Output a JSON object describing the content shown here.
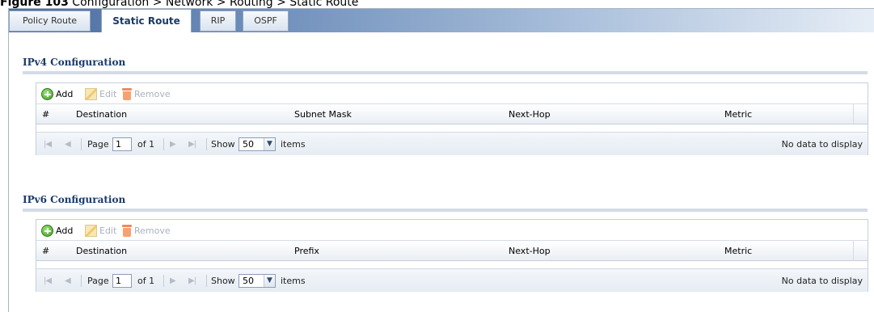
{
  "caption": {
    "figure": "Figure 103",
    "path": "  Configuration > Network > Routing > Static Route"
  },
  "tabs": [
    {
      "label": "Policy Route",
      "active": false
    },
    {
      "label": "Static Route",
      "active": true
    },
    {
      "label": "RIP",
      "active": false
    },
    {
      "label": "OSPF",
      "active": false
    }
  ],
  "ipv4": {
    "title": "IPv4 Configuration",
    "toolbar": {
      "add": "Add",
      "edit": "Edit",
      "remove": "Remove"
    },
    "columns": [
      "#",
      "Destination",
      "Subnet Mask",
      "Next-Hop",
      "Metric"
    ],
    "pager": {
      "page_label": "Page",
      "page_value": "1",
      "of_label": "of 1",
      "show_label": "Show",
      "show_value": "50",
      "items_label": "items",
      "empty_text": "No data to display"
    }
  },
  "ipv6": {
    "title": "IPv6 Configuration",
    "toolbar": {
      "add": "Add",
      "edit": "Edit",
      "remove": "Remove"
    },
    "columns": [
      "#",
      "Destination",
      "Prefix",
      "Next-Hop",
      "Metric"
    ],
    "pager": {
      "page_label": "Page",
      "page_value": "1",
      "of_label": "of 1",
      "show_label": "Show",
      "show_value": "50",
      "items_label": "items",
      "empty_text": "No data to display"
    }
  },
  "icons": {
    "add": "add-circle-icon",
    "edit": "edit-pencil-icon",
    "remove": "trash-icon",
    "first": "first-page-icon",
    "prev": "prev-page-icon",
    "next": "next-page-icon",
    "last": "last-page-icon",
    "dropdown": "chevron-down-icon"
  },
  "colors": {
    "tab_gradient_start": "#4a6ea0",
    "section_title": "#183a6b",
    "add_icon": "#3f9b28",
    "remove_icon": "#f08a5a"
  }
}
